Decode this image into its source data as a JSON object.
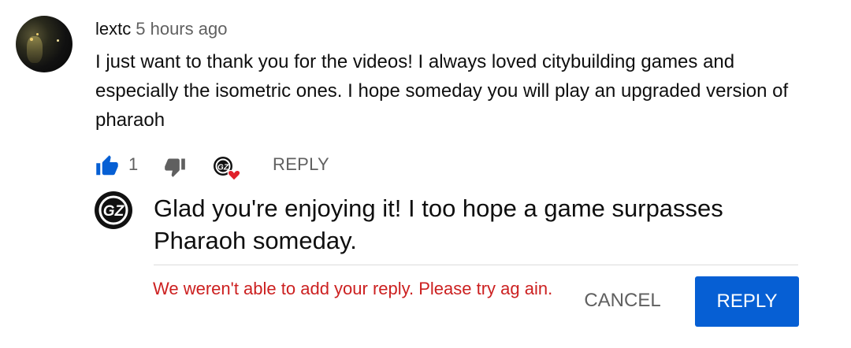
{
  "comment": {
    "author": "lextc",
    "time": "5 hours ago",
    "text": "I just want to thank you for the videos! I always loved citybuilding games and especially the isometric ones. I hope someday you will play an upgraded version of pharaoh",
    "like_count": "1",
    "reply_label": "REPLY"
  },
  "reply_draft": {
    "text": "Glad you're enjoying it! I too hope a game surpasses Pharaoh someday.",
    "error": "We weren't able to add your reply. Please try ag ain.",
    "cancel_label": "CANCEL",
    "submit_label": "REPLY"
  },
  "icons": {
    "like": "thumbs-up-icon",
    "dislike": "thumbs-down-icon",
    "creator_heart": "creator-heart-icon",
    "channel_avatar": "gz-logo"
  },
  "colors": {
    "accent_blue": "#065fd4",
    "like_active": "#065fd4",
    "error_red": "#cc2020",
    "heart_red": "#e0202a",
    "secondary_text": "#606060"
  }
}
